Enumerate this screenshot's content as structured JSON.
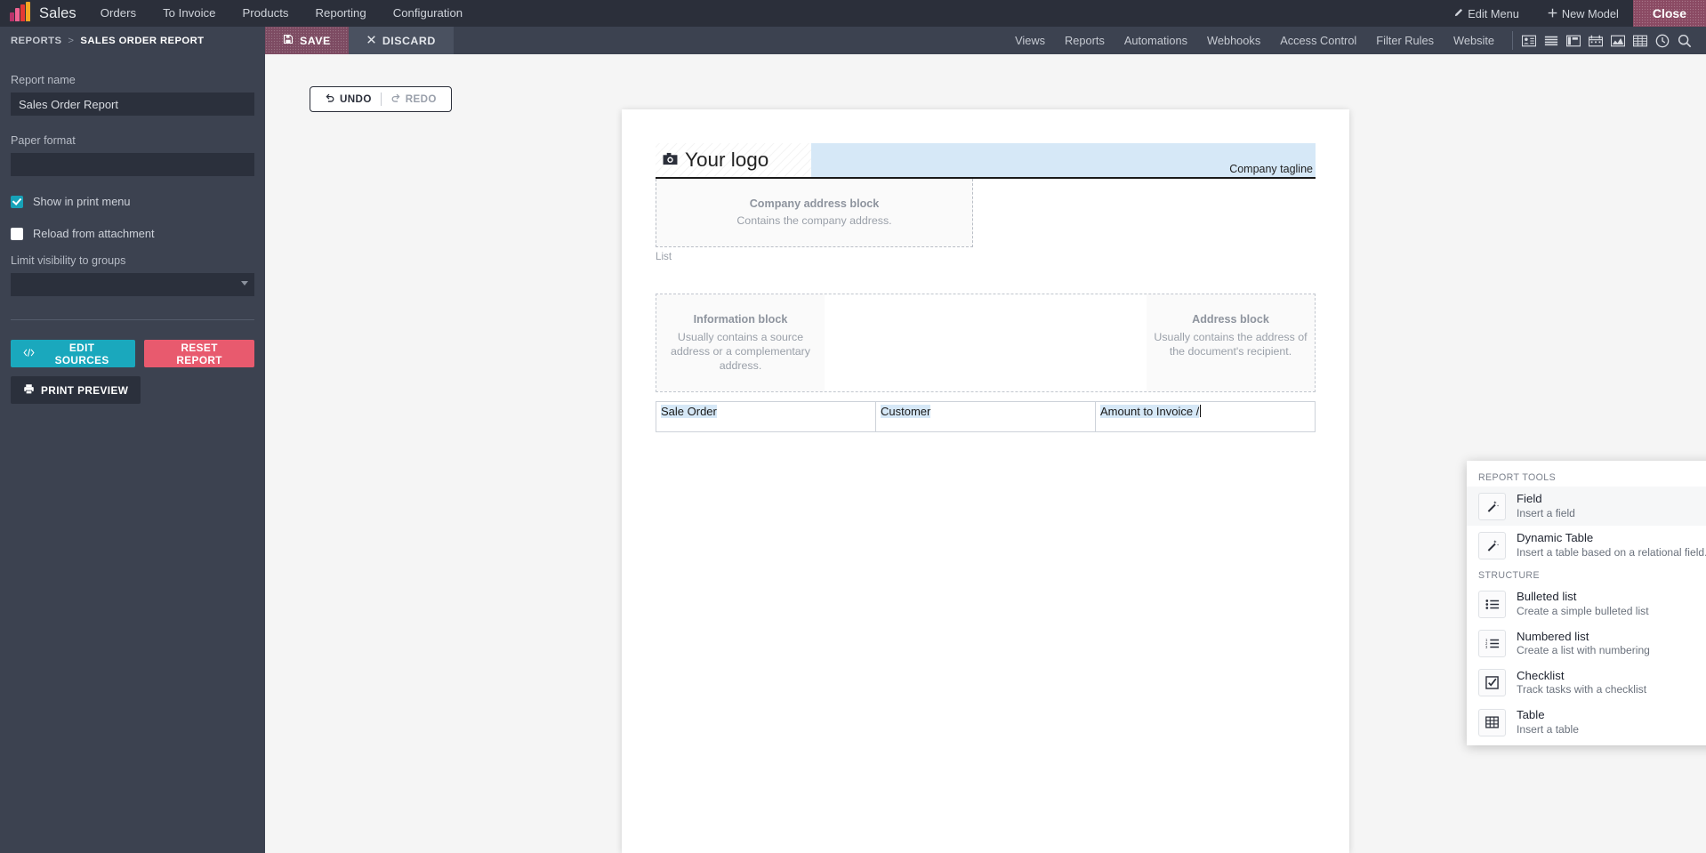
{
  "topbar": {
    "logo_icon": "bar-chart-logo-icon",
    "brand": "Sales",
    "menu": [
      {
        "label": "Orders"
      },
      {
        "label": "To Invoice"
      },
      {
        "label": "Products"
      },
      {
        "label": "Reporting"
      },
      {
        "label": "Configuration"
      }
    ],
    "edit_menu": "Edit Menu",
    "edit_menu_icon": "pencil-icon",
    "new_model": "New Model",
    "new_model_icon": "plus-icon",
    "close": "Close"
  },
  "subbar": {
    "breadcrumb_root": "REPORTS",
    "breadcrumb_sep": ">",
    "breadcrumb_current": "SALES ORDER REPORT",
    "save": "SAVE",
    "save_icon": "floppy-disk-icon",
    "discard": "DISCARD",
    "discard_icon": "close-x-icon",
    "nav": [
      {
        "label": "Views"
      },
      {
        "label": "Reports"
      },
      {
        "label": "Automations"
      },
      {
        "label": "Webhooks"
      },
      {
        "label": "Access Control"
      },
      {
        "label": "Filter Rules"
      },
      {
        "label": "Website"
      }
    ],
    "view_icons": [
      "kanban-card-icon",
      "list-view-icon",
      "gantt-view-icon",
      "calendar-view-icon",
      "graph-view-icon",
      "pivot-view-icon",
      "activity-clock-icon",
      "search-icon"
    ]
  },
  "sidebar": {
    "report_name_label": "Report name",
    "report_name_value": "Sales Order Report",
    "paper_format_label": "Paper format",
    "paper_format_value": "",
    "show_in_print_menu": "Show in print menu",
    "show_in_print_menu_checked": true,
    "reload_from_attachment": "Reload from attachment",
    "reload_from_attachment_checked": false,
    "limit_visibility_label": "Limit visibility to groups",
    "limit_visibility_value": "",
    "edit_sources": "EDIT SOURCES",
    "edit_sources_icon": "code-icon",
    "reset_report": "RESET REPORT",
    "print_preview": "PRINT PREVIEW",
    "print_preview_icon": "printer-icon",
    "accent_teal": "#1aa8bd",
    "accent_red": "#e85a6e"
  },
  "canvas": {
    "undo": "UNDO",
    "undo_icon": "undo-arrow-icon",
    "redo": "REDO",
    "redo_icon": "redo-arrow-icon"
  },
  "document": {
    "logo_placeholder": "Your logo",
    "logo_icon": "camera-icon",
    "company_tagline": "Company tagline",
    "company_address_title": "Company address block",
    "company_address_desc": "Contains the company address.",
    "list_tag": "List",
    "information_block_title": "Information block",
    "information_block_desc": "Usually contains a source address or a complementary address.",
    "address_block_title": "Address block",
    "address_block_desc": "Usually contains the address of the document's recipient.",
    "table_headers": [
      "Sale Order",
      "Customer",
      "Amount to Invoice /"
    ],
    "highlight_color": "#d6e8f7"
  },
  "popup": {
    "outline_color": "#ff0000",
    "sections": [
      {
        "title": "REPORT TOOLS",
        "items": [
          {
            "name": "Field",
            "desc": "Insert a field",
            "icon": "magic-wand-icon",
            "active": true
          },
          {
            "name": "Dynamic Table",
            "desc": "Insert a table based on a relational field.",
            "icon": "magic-wand-icon",
            "active": false
          }
        ]
      },
      {
        "title": "STRUCTURE",
        "items": [
          {
            "name": "Bulleted list",
            "desc": "Create a simple bulleted list",
            "icon": "bulleted-list-icon",
            "active": false
          },
          {
            "name": "Numbered list",
            "desc": "Create a list with numbering",
            "icon": "numbered-list-icon",
            "active": false
          },
          {
            "name": "Checklist",
            "desc": "Track tasks with a checklist",
            "icon": "checklist-icon",
            "active": false
          },
          {
            "name": "Table",
            "desc": "Insert a table",
            "icon": "table-grid-icon",
            "active": false
          }
        ]
      }
    ]
  }
}
